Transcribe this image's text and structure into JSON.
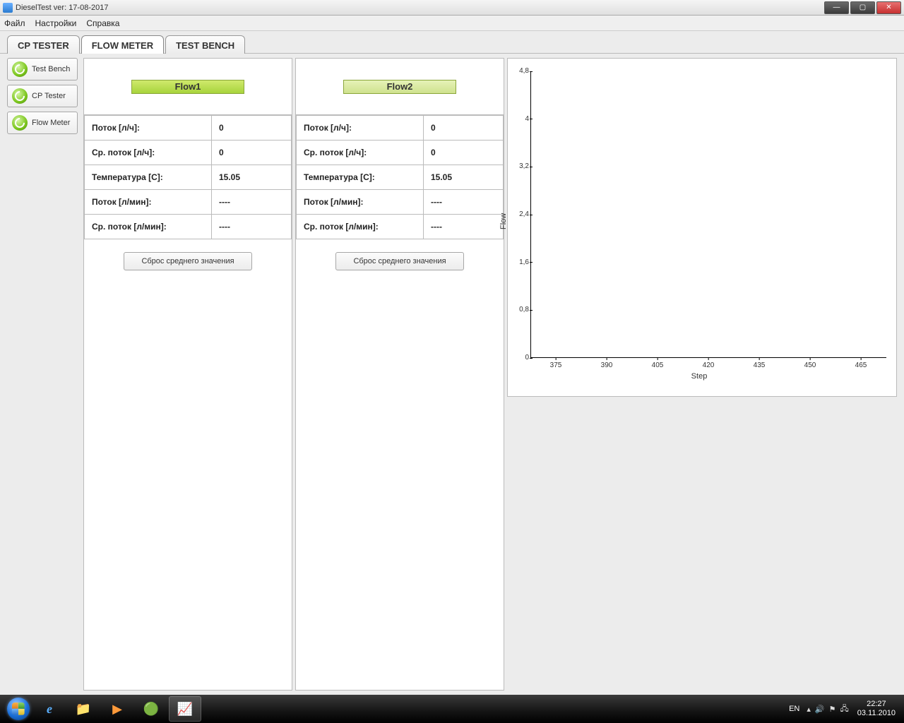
{
  "window": {
    "title": "DieselTest ver: 17-08-2017"
  },
  "menu": {
    "file": "Файл",
    "settings": "Настройки",
    "help": "Справка"
  },
  "tabs": {
    "cp": "CP TESTER",
    "flow": "FLOW METER",
    "bench": "TEST BENCH"
  },
  "sidebar": {
    "test_bench": "Test Bench",
    "cp_tester": "CP Tester",
    "flow_meter": "Flow Meter"
  },
  "labels": {
    "flow_lh": "Поток [л/ч]:",
    "avg_flow_lh": "Ср. поток [л/ч]:",
    "temp_c": "Температура [C]:",
    "flow_lmin": "Поток [л/мин]:",
    "avg_flow_lmin": "Ср. поток [л/мин]:",
    "reset_avg": "Сброс среднего значения"
  },
  "flow1": {
    "title": "Flow1",
    "flow_lh": "0",
    "avg_flow_lh": "0",
    "temp_c": "15.05",
    "flow_lmin": "----",
    "avg_flow_lmin": "----"
  },
  "flow2": {
    "title": "Flow2",
    "flow_lh": "0",
    "avg_flow_lh": "0",
    "temp_c": "15.05",
    "flow_lmin": "----",
    "avg_flow_lmin": "----"
  },
  "chart_data": {
    "type": "line",
    "title": "",
    "xlabel": "Step",
    "ylabel": "Flow",
    "x_ticks": [
      "375",
      "390",
      "405",
      "420",
      "435",
      "450",
      "465"
    ],
    "y_ticks": [
      "0",
      "0,8",
      "1,6",
      "2,4",
      "3,2",
      "4",
      "4,8"
    ],
    "xlim": [
      370,
      470
    ],
    "ylim": [
      0,
      5
    ],
    "series": []
  },
  "taskbar": {
    "lang": "EN",
    "time": "22:27",
    "date": "03.11.2010"
  }
}
